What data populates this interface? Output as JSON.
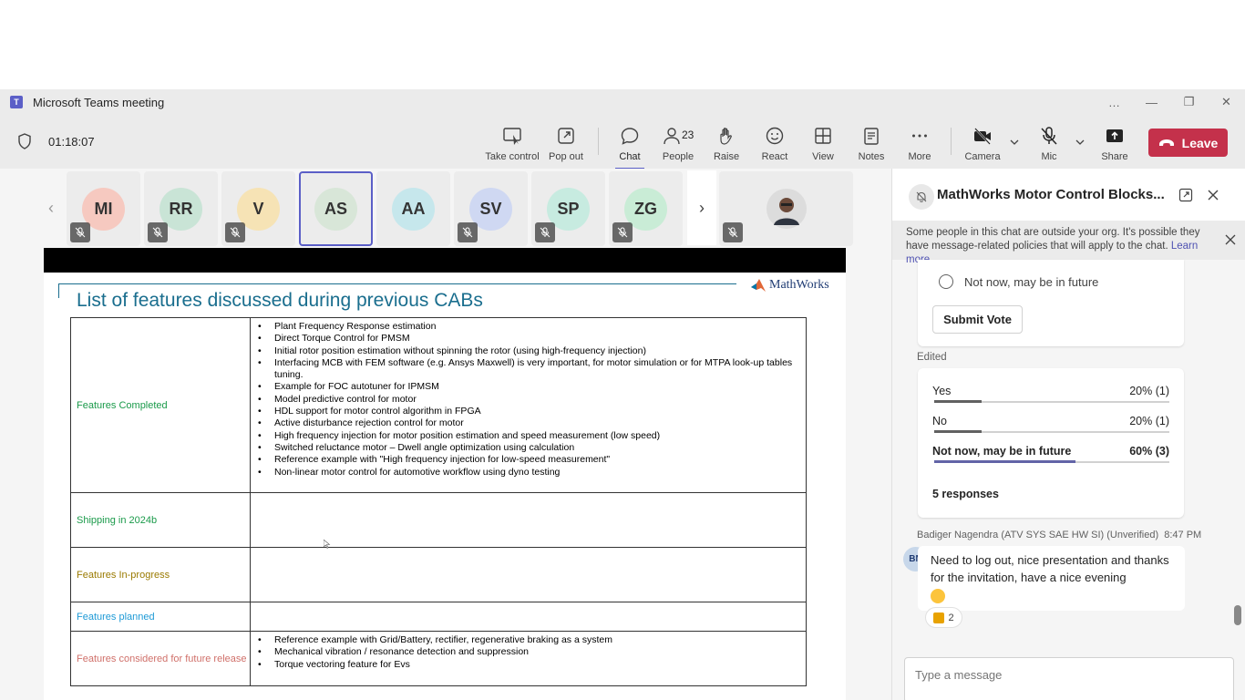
{
  "window": {
    "title": "Microsoft Teams meeting",
    "controls": [
      "…",
      "—",
      "❐",
      "✕"
    ]
  },
  "toolbar": {
    "timer": "01:18:07",
    "buttons": {
      "take_control": "Take control",
      "pop_out": "Pop out",
      "chat": "Chat",
      "people": "People",
      "people_count": "23",
      "raise": "Raise",
      "react": "React",
      "view": "View",
      "notes": "Notes",
      "more": "More",
      "camera": "Camera",
      "mic": "Mic",
      "share": "Share",
      "leave": "Leave"
    }
  },
  "participants": [
    {
      "initials": "MI",
      "color": "#f6c9c0"
    },
    {
      "initials": "RR",
      "color": "#c9e4d6"
    },
    {
      "initials": "V",
      "color": "#f6e3b5"
    },
    {
      "initials": "AS",
      "color": "#d8e6d8"
    },
    {
      "initials": "AA",
      "color": "#c6e7ec"
    },
    {
      "initials": "SV",
      "color": "#cfd8f2"
    },
    {
      "initials": "SP",
      "color": "#c7ebe0"
    },
    {
      "initials": "ZG",
      "color": "#c9ecd6"
    }
  ],
  "slide": {
    "logo_text": "MathWorks",
    "title": "List of features discussed during previous CABs",
    "rows": [
      {
        "label": "Features Completed",
        "color": "#1a9a4a",
        "items": [
          "Plant Frequency Response estimation",
          "Direct Torque Control for PMSM",
          "Initial rotor position estimation without spinning the rotor (using high-frequency injection)",
          "Interfacing MCB with FEM software (e.g. Ansys Maxwell) is very important, for motor simulation or for MTPA look-up tables tuning.",
          "Example for FOC autotuner for IPMSM",
          "Model predictive control for motor",
          "HDL support for motor control algorithm in FPGA",
          "Active disturbance rejection control for motor",
          "High frequency injection for motor position estimation and speed measurement (low speed)",
          "Switched reluctance motor – Dwell angle optimization using calculation",
          "Reference example with \"High frequency injection for low-speed measurement\"",
          "Non-linear motor control for automotive workflow using dyno testing"
        ]
      },
      {
        "label": "Shipping in 2024b",
        "color": "#1a9a4a",
        "items": []
      },
      {
        "label": "Features In-progress",
        "color": "#9a7a00",
        "items": []
      },
      {
        "label": "Features planned",
        "color": "#1e9ad6",
        "items": []
      },
      {
        "label": "Features considered for future release",
        "color": "#d0706a",
        "items": [
          "Reference example with Grid/Battery, rectifier, regenerative braking as a system",
          "Mechanical vibration / resonance detection and suppression",
          "Torque vectoring feature for Evs"
        ]
      }
    ]
  },
  "chat": {
    "title": "MathWorks Motor Control Blocks...",
    "notice": "Some people in this chat are outside your org. It's possible they have message-related policies that will apply to the chat.",
    "notice_link": "Learn more",
    "poll_option_last": "Not now, may be in future",
    "submit_label": "Submit Vote",
    "edited_label": "Edited",
    "results": [
      {
        "label": "Yes",
        "value": "20% (1)",
        "fraction": 0.2
      },
      {
        "label": "No",
        "value": "20% (1)",
        "fraction": 0.2
      },
      {
        "label": "Not now, may be in future",
        "value": "60% (3)",
        "fraction": 0.6
      }
    ],
    "responses": "5 responses",
    "message": {
      "sender": "Badiger Nagendra (ATV SYS SAE HW SI) (Unverified)",
      "time": "8:47 PM",
      "initials": "BN",
      "text": "Need to log out, nice presentation and thanks for the invitation, have a nice evening",
      "reaction_count": "2"
    },
    "compose_placeholder": "Type a message"
  }
}
